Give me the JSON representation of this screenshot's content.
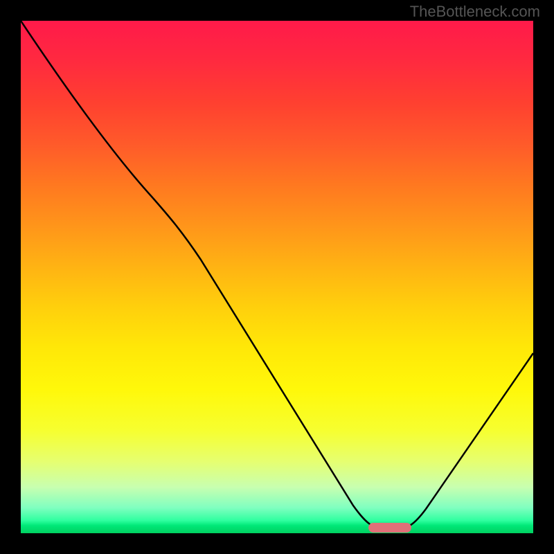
{
  "watermark": "TheBottleneck.com",
  "chart_data": {
    "type": "line",
    "title": "",
    "xlabel": "",
    "ylabel": "",
    "x": [
      0,
      5,
      10,
      15,
      20,
      25,
      30,
      35,
      40,
      45,
      50,
      55,
      60,
      65,
      70,
      72,
      74,
      76,
      80,
      85,
      90,
      95,
      100
    ],
    "values": [
      100,
      92,
      84,
      76,
      70,
      64,
      58,
      50,
      42,
      33,
      24,
      16,
      10,
      5,
      2,
      1,
      1,
      2,
      5,
      11,
      19,
      29,
      40
    ],
    "marker": {
      "x_start": 69,
      "x_end": 77,
      "y": 1
    },
    "xlim": [
      0,
      100
    ],
    "ylim": [
      0,
      100
    ],
    "grid": false,
    "background_gradient": [
      "#ff1a4a",
      "#ffd00c",
      "#fff80a",
      "#00d060"
    ]
  }
}
